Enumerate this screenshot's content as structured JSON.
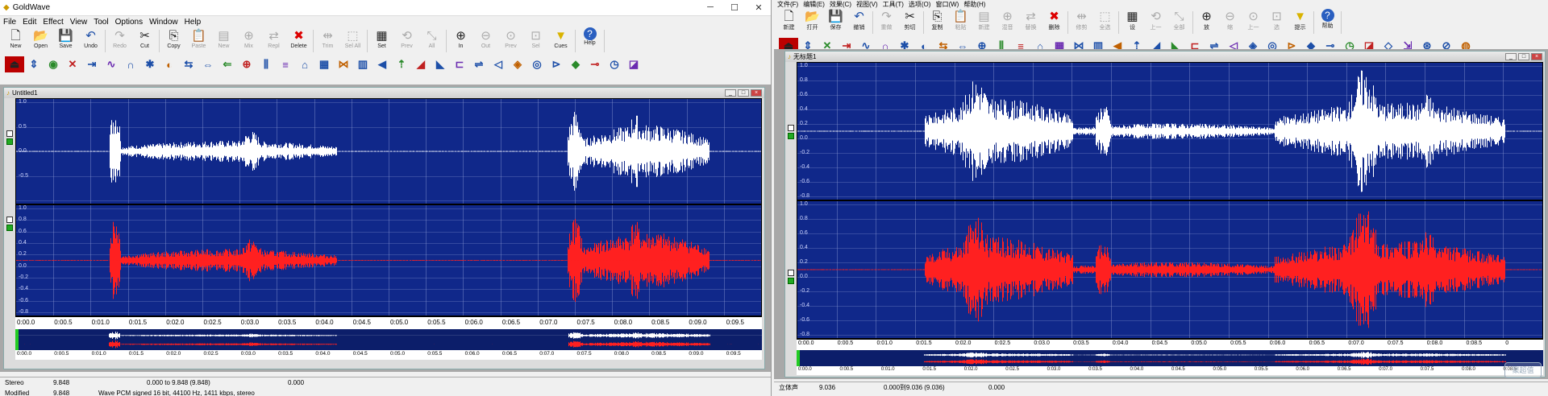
{
  "win1": {
    "title": "GoldWave",
    "menu": [
      "File",
      "Edit",
      "Effect",
      "View",
      "Tool",
      "Options",
      "Window",
      "Help"
    ],
    "toolbar": [
      {
        "label": "New",
        "icon": "new-file-icon",
        "glyph": "🗋",
        "enabled": true
      },
      {
        "label": "Open",
        "icon": "open-folder-icon",
        "glyph": "📂",
        "enabled": true
      },
      {
        "label": "Save",
        "icon": "save-icon",
        "glyph": "💾",
        "enabled": true
      },
      {
        "label": "Undo",
        "icon": "undo-icon",
        "glyph": "↶",
        "enabled": true
      },
      {
        "label": "Redo",
        "icon": "redo-icon",
        "glyph": "↷",
        "enabled": false
      },
      {
        "label": "Cut",
        "icon": "cut-icon",
        "glyph": "✂",
        "enabled": true
      },
      {
        "label": "Copy",
        "icon": "copy-icon",
        "glyph": "⎘",
        "enabled": true
      },
      {
        "label": "Paste",
        "icon": "paste-icon",
        "glyph": "📋",
        "enabled": false
      },
      {
        "label": "New",
        "icon": "paste-new-icon",
        "glyph": "▤",
        "enabled": false
      },
      {
        "label": "Mix",
        "icon": "mix-icon",
        "glyph": "⊕",
        "enabled": false
      },
      {
        "label": "Repl",
        "icon": "replace-icon",
        "glyph": "⇄",
        "enabled": false
      },
      {
        "label": "Delete",
        "icon": "delete-icon",
        "glyph": "✖",
        "enabled": true
      },
      {
        "label": "Trim",
        "icon": "trim-icon",
        "glyph": "⇹",
        "enabled": false
      },
      {
        "label": "Sel All",
        "icon": "select-all-icon",
        "glyph": "⬚",
        "enabled": false
      },
      {
        "label": "Set",
        "icon": "set-icon",
        "glyph": "▦",
        "enabled": true
      },
      {
        "label": "Prev",
        "icon": "prev-icon",
        "glyph": "⟲",
        "enabled": false
      },
      {
        "label": "All",
        "icon": "zoom-all-icon",
        "glyph": "⤡",
        "enabled": false
      },
      {
        "label": "In",
        "icon": "zoom-in-icon",
        "glyph": "⊕",
        "enabled": true
      },
      {
        "label": "Out",
        "icon": "zoom-out-icon",
        "glyph": "⊖",
        "enabled": false
      },
      {
        "label": "Prev",
        "icon": "zoom-prev-icon",
        "glyph": "⊙",
        "enabled": false
      },
      {
        "label": "Sel",
        "icon": "zoom-sel-icon",
        "glyph": "⊡",
        "enabled": false
      },
      {
        "label": "Cues",
        "icon": "cues-icon",
        "glyph": "▼",
        "enabled": true
      },
      {
        "label": "Help",
        "icon": "help-icon",
        "glyph": "?",
        "enabled": true
      }
    ],
    "effects": [
      "⏏",
      "⇕",
      "◉",
      "✕",
      "⇥",
      "∿",
      "∩",
      "✱",
      "◐",
      "⇆",
      "⇔",
      "⇐",
      "⊕",
      "⫼",
      "≡",
      "⌂",
      "▦",
      "⋈",
      "▥",
      "◀",
      "⇡",
      "◢",
      "◣",
      "⊏",
      "⇌",
      "◁",
      "◈",
      "◎",
      "⊳",
      "◆",
      "⊸",
      "◷",
      "◪"
    ],
    "doc_title": "Untitled1",
    "y_ticks": [
      "1.0",
      "0.5",
      "0.0",
      "-0.5",
      "",
      "1.0",
      "0.8",
      "0.6",
      "0.4",
      "0.2",
      "0.0",
      "-0.2",
      "-0.4",
      "-0.6",
      "-0.8"
    ],
    "time_ticks": [
      "0:00.0",
      "0:00.5",
      "0:01.0",
      "0:01.5",
      "0:02.0",
      "0:02.5",
      "0:03.0",
      "0:03.5",
      "0:04.0",
      "0:04.5",
      "0:05.0",
      "0:05.5",
      "0:06.0",
      "0:06.5",
      "0:07.0",
      "0:07.5",
      "0:08.0",
      "0:08.5",
      "0:09.0",
      "0:09.5"
    ],
    "overview_ticks": [
      "0:00.0",
      "0:00.5",
      "0:01.0",
      "0:01.5",
      "0:02.0",
      "0:02.5",
      "0:03.0",
      "0:03.5",
      "0:04.0",
      "0:04.5",
      "0:05.0",
      "0:05.5",
      "0:06.0",
      "0:06.5",
      "0:07.0",
      "0:07.5",
      "0:08.0",
      "0:08.5",
      "0:09.0",
      "0:09.5"
    ],
    "status": {
      "channel": "Stereo",
      "length": "9.848",
      "selection": "0.000 to 9.848 (9.848)",
      "position": "0.000",
      "state": "Modified",
      "length2": "9.848",
      "format": "Wave PCM signed 16 bit, 44100 Hz, 1411 kbps, stereo"
    },
    "colors": {
      "left": "#ffffff",
      "right": "#ff2020",
      "bg": "#10288a"
    }
  },
  "win2": {
    "menu": [
      "文件(F)",
      "编辑(E)",
      "效果(C)",
      "视图(V)",
      "工具(T)",
      "选项(O)",
      "窗口(W)",
      "帮助(H)"
    ],
    "toolbar": [
      {
        "label": "新建",
        "icon": "new-file-icon",
        "glyph": "🗋",
        "enabled": true
      },
      {
        "label": "打开",
        "icon": "open-folder-icon",
        "glyph": "📂",
        "enabled": true
      },
      {
        "label": "保存",
        "icon": "save-icon",
        "glyph": "💾",
        "enabled": true
      },
      {
        "label": "撤销",
        "icon": "undo-icon",
        "glyph": "↶",
        "enabled": true
      },
      {
        "label": "重做",
        "icon": "redo-icon",
        "glyph": "↷",
        "enabled": false
      },
      {
        "label": "剪切",
        "icon": "cut-icon",
        "glyph": "✂",
        "enabled": true
      },
      {
        "label": "复制",
        "icon": "copy-icon",
        "glyph": "⎘",
        "enabled": true
      },
      {
        "label": "粘贴",
        "icon": "paste-icon",
        "glyph": "📋",
        "enabled": false
      },
      {
        "label": "新建",
        "icon": "paste-new-icon",
        "glyph": "▤",
        "enabled": false
      },
      {
        "label": "混音",
        "icon": "mix-icon",
        "glyph": "⊕",
        "enabled": false
      },
      {
        "label": "替换",
        "icon": "replace-icon",
        "glyph": "⇄",
        "enabled": false
      },
      {
        "label": "删除",
        "icon": "delete-icon",
        "glyph": "✖",
        "enabled": true
      },
      {
        "label": "修剪",
        "icon": "trim-icon",
        "glyph": "⇹",
        "enabled": false
      },
      {
        "label": "全选",
        "icon": "select-all-icon",
        "glyph": "⬚",
        "enabled": false
      },
      {
        "label": "设",
        "icon": "set-icon",
        "glyph": "▦",
        "enabled": true
      },
      {
        "label": "上一",
        "icon": "prev-icon",
        "glyph": "⟲",
        "enabled": false
      },
      {
        "label": "全部",
        "icon": "zoom-all-icon",
        "glyph": "⤡",
        "enabled": false
      },
      {
        "label": "放",
        "icon": "zoom-in-icon",
        "glyph": "⊕",
        "enabled": true
      },
      {
        "label": "缩",
        "icon": "zoom-out-icon",
        "glyph": "⊖",
        "enabled": false
      },
      {
        "label": "上一",
        "icon": "zoom-prev-icon",
        "glyph": "⊙",
        "enabled": false
      },
      {
        "label": "选",
        "icon": "zoom-sel-icon",
        "glyph": "⊡",
        "enabled": false
      },
      {
        "label": "提示",
        "icon": "cues-icon",
        "glyph": "▼",
        "enabled": true
      },
      {
        "label": "帮助",
        "icon": "help-icon",
        "glyph": "?",
        "enabled": true
      }
    ],
    "effects": [
      "⏏",
      "⇕",
      "✕",
      "⇥",
      "∿",
      "∩",
      "✱",
      "◐",
      "⇆",
      "⇔",
      "⊕",
      "⫼",
      "≡",
      "⌂",
      "▦",
      "⋈",
      "▥",
      "◀",
      "⇡",
      "◢",
      "◣",
      "⊏",
      "⇌",
      "◁",
      "◈",
      "◎",
      "⊳",
      "◆",
      "⊸",
      "◷",
      "◪",
      "◇",
      "⇲",
      "⊛",
      "⊘",
      "◍"
    ],
    "doc_title": "无标题1",
    "y_ticks": [
      "1.0",
      "0.8",
      "0.6",
      "0.4",
      "0.2",
      "0.0",
      "-0.2",
      "-0.4",
      "-0.6",
      "-0.8",
      "",
      "1.0",
      "0.8",
      "0.6",
      "0.4",
      "0.2",
      "0.0",
      "-0.2",
      "-0.4",
      "-0.6",
      "-0.8"
    ],
    "time_ticks": [
      "0:00.0",
      "0:00.5",
      "0:01.0",
      "0:01.5",
      "0:02.0",
      "0:02.5",
      "0:03.0",
      "0:03.5",
      "0:04.0",
      "0:04.5",
      "0:05.0",
      "0:05.5",
      "0:06.0",
      "0:06.5",
      "0:07.0",
      "0:07.5",
      "0:08.0",
      "0:08.5",
      "0"
    ],
    "overview_ticks": [
      "0:00.0",
      "0:00.5",
      "0:01.0",
      "0:01.5",
      "0:02.0",
      "0:02.5",
      "0:03.0",
      "0:03.5",
      "0:04.0",
      "0:04.5",
      "0:05.0",
      "0:05.5",
      "0:06.0",
      "0:06.5",
      "0:07.0",
      "0:07.5",
      "0:08.0",
      "0:08.5"
    ],
    "status": {
      "channel": "立体声",
      "length": "9.036",
      "selection": "0.000到9.036 (9.036)",
      "position": "0.000"
    },
    "watermark": "聚超值",
    "colors": {
      "left": "#ffffff",
      "right": "#ff2020",
      "bg": "#10288a"
    }
  }
}
